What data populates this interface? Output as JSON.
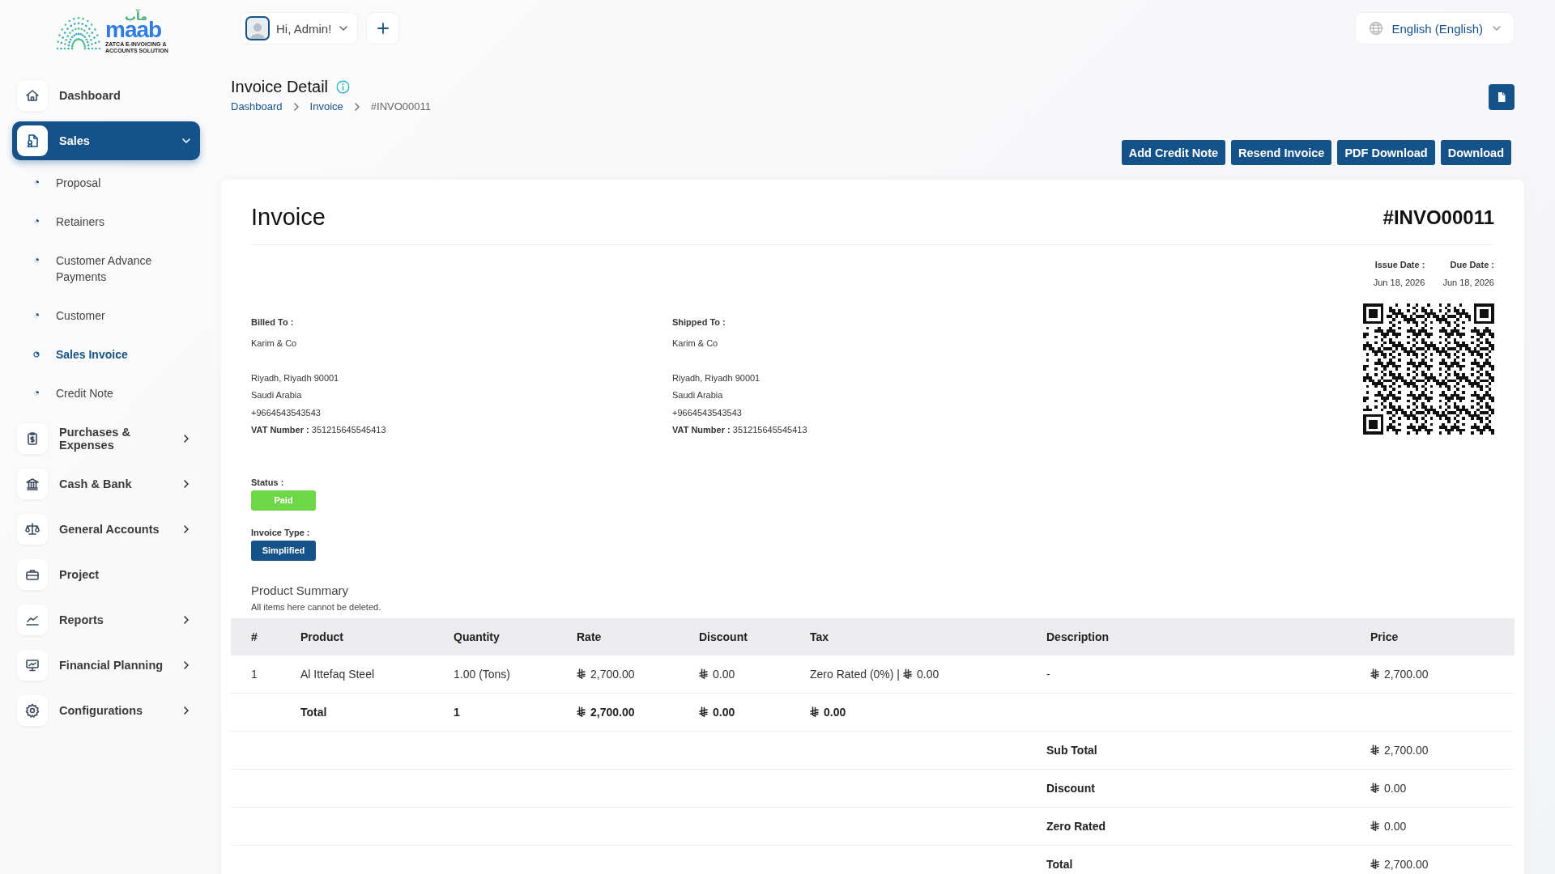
{
  "logo": {
    "latin": "maab",
    "arabic": "مآب",
    "tagline": [
      "ZATCA E-INVOICING &",
      "ACCOUNTS SOLUTION"
    ]
  },
  "header": {
    "user": "Hi, Admin!",
    "language": "English (English)"
  },
  "sidebar": {
    "items": [
      {
        "label": "Dashboard",
        "kind": "link",
        "selected": false
      },
      {
        "label": "Sales",
        "kind": "group",
        "expanded": true,
        "selected": true,
        "children": [
          {
            "label": "Proposal",
            "selected": false
          },
          {
            "label": "Retainers",
            "selected": false
          },
          {
            "label": "Customer Advance Payments",
            "selected": false
          },
          {
            "label": "Customer",
            "selected": false
          },
          {
            "label": "Sales Invoice",
            "selected": true
          },
          {
            "label": "Credit Note",
            "selected": false
          }
        ]
      },
      {
        "label": "Purchases & Expenses",
        "kind": "group",
        "expanded": false,
        "selected": false
      },
      {
        "label": "Cash & Bank",
        "kind": "group",
        "expanded": false,
        "selected": false
      },
      {
        "label": "General Accounts",
        "kind": "group",
        "expanded": false,
        "selected": false
      },
      {
        "label": "Project",
        "kind": "link",
        "selected": false
      },
      {
        "label": "Reports",
        "kind": "group",
        "expanded": false,
        "selected": false
      },
      {
        "label": "Financial Planning",
        "kind": "group",
        "expanded": false,
        "selected": false
      },
      {
        "label": "Configurations",
        "kind": "group",
        "expanded": false,
        "selected": false
      }
    ]
  },
  "page": {
    "title": "Invoice Detail",
    "breadcrumbs": [
      {
        "label": "Dashboard",
        "kind": "link"
      },
      {
        "label": "Invoice",
        "kind": "link"
      },
      {
        "label": "#INVO00011",
        "kind": "current"
      }
    ],
    "actions": [
      "Add Credit Note",
      "Resend Invoice",
      "PDF Download",
      "Download"
    ]
  },
  "invoice": {
    "title": "Invoice",
    "number": "#INVO00011",
    "dates": [
      {
        "label": "Issue Date :",
        "value": "Jun 18, 2026"
      },
      {
        "label": "Due Date :",
        "value": "Jun 18, 2026"
      }
    ],
    "addresses": [
      {
        "label": "Billed To :",
        "lines": [
          "Karim & Co",
          "Riyadh, Riyadh 90001",
          "Saudi Arabia",
          "+9664543543543",
          "**VAT Number :** 351215645545413"
        ]
      },
      {
        "label": "Shipped To :",
        "lines": [
          "Karim & Co",
          "Riyadh, Riyadh 90001",
          "Saudi Arabia",
          "+9664543543543",
          "**VAT Number :** 351215645545413"
        ]
      }
    ],
    "badges": [
      {
        "label": "Status :",
        "value": "Paid",
        "kind": "success"
      },
      {
        "label": "Invoice Type :",
        "value": "Simplified",
        "kind": "primary"
      }
    ],
    "summary_title": "Product Summary",
    "summary_note": "All items here cannot be deleted."
  },
  "table": {
    "columns": [
      "#",
      "Product",
      "Quantity",
      "Rate",
      "Discount",
      "Tax",
      "Description",
      "Price"
    ],
    "rows": [
      {
        "kind": "item",
        "cells": [
          {
            "text": "1"
          },
          {
            "text": "Al Ittefaq Steel"
          },
          {
            "text": "1.00 (Tons)"
          },
          {
            "text": "2,700.00",
            "currency": true
          },
          {
            "text": "0.00",
            "currency": true
          },
          {
            "prefix": "Zero Rated (0%) |",
            "text": "0.00",
            "currency": true
          },
          {
            "text": "-"
          },
          {
            "text": "2,700.00",
            "currency": true
          }
        ]
      },
      {
        "kind": "total",
        "cells": [
          {
            "text": ""
          },
          {
            "text": "Total"
          },
          {
            "text": "1"
          },
          {
            "text": "2,700.00",
            "currency": true
          },
          {
            "text": "0.00",
            "currency": true
          },
          {
            "text": "0.00",
            "currency": true
          }
        ]
      }
    ],
    "summary": [
      {
        "label": "Sub Total",
        "value": "2,700.00"
      },
      {
        "label": "Discount",
        "value": "0.00"
      },
      {
        "label": "Zero Rated",
        "value": "0.00"
      },
      {
        "label": "Total",
        "value": "2,700.00"
      }
    ]
  }
}
